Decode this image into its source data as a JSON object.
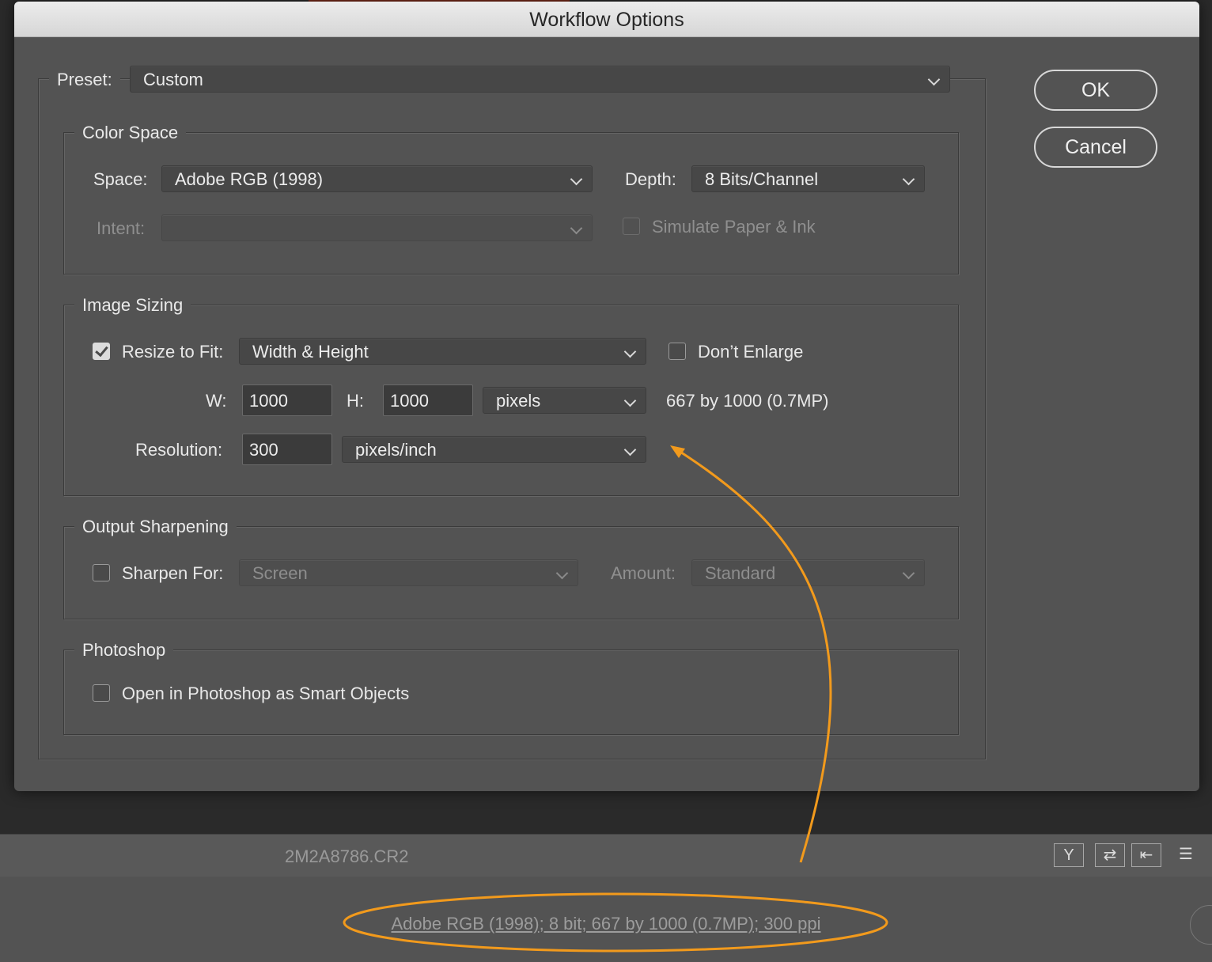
{
  "window": {
    "title": "Workflow Options"
  },
  "preset": {
    "label": "Preset:",
    "value": "Custom"
  },
  "buttons": {
    "ok": "OK",
    "cancel": "Cancel"
  },
  "color_space": {
    "title": "Color Space",
    "space_label": "Space:",
    "space_value": "Adobe RGB (1998)",
    "depth_label": "Depth:",
    "depth_value": "8 Bits/Channel",
    "intent_label": "Intent:",
    "intent_value": "",
    "simulate_label": "Simulate Paper & Ink",
    "simulate_checked": false
  },
  "image_sizing": {
    "title": "Image Sizing",
    "resize_label": "Resize to Fit:",
    "resize_checked": true,
    "resize_value": "Width & Height",
    "dont_enlarge_label": "Don’t Enlarge",
    "dont_enlarge_checked": false,
    "w_label": "W:",
    "w_value": "1000",
    "h_label": "H:",
    "h_value": "1000",
    "unit_value": "pixels",
    "size_info": "667 by 1000 (0.7MP)",
    "resolution_label": "Resolution:",
    "resolution_value": "300",
    "resolution_unit": "pixels/inch"
  },
  "output_sharpening": {
    "title": "Output Sharpening",
    "sharpen_label": "Sharpen For:",
    "sharpen_checked": false,
    "sharpen_value": "Screen",
    "amount_label": "Amount:",
    "amount_value": "Standard"
  },
  "photoshop": {
    "title": "Photoshop",
    "smart_objects_label": "Open in Photoshop as Smart Objects",
    "smart_objects_checked": false
  },
  "filmstrip": {
    "filename": "2M2A8786.CR2"
  },
  "toolbar_icons": [
    "filter-icon",
    "swap-icon",
    "back-icon",
    "sliders-icon"
  ],
  "footer": {
    "workflow_link": "Adobe RGB (1998); 8 bit; 667 by 1000 (0.7MP); 300 ppi"
  },
  "colors": {
    "annotation": "#f29a1c",
    "dialog_bg": "#535353"
  }
}
